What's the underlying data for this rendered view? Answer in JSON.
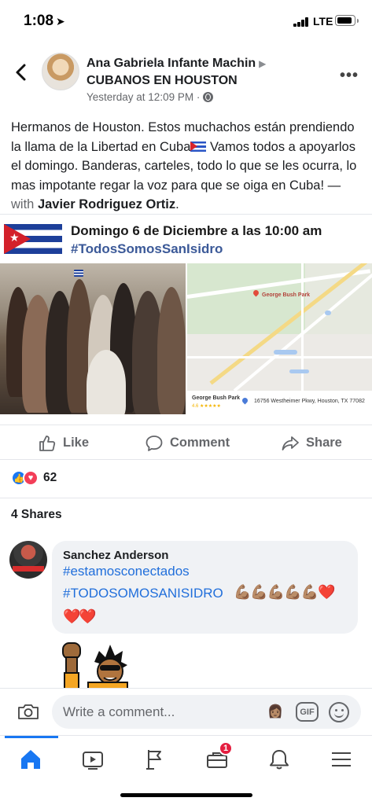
{
  "status_bar": {
    "time": "1:08",
    "network": "LTE"
  },
  "post": {
    "author": "Ana Gabriela Infante Machin",
    "group": "CUBANOS EN HOUSTON",
    "timestamp": "Yesterday at 12:09 PM · ",
    "text_part1": "Hermanos de Houston. Estos muchachos están prendiendo la llama de la Libertad en Cuba",
    "text_part2": " Vamos todos a apoyarlos el domingo. Banderas, carteles, todo lo que se les ocurra, lo mas impotante regar la voz para que se oiga en Cuba! — ",
    "with_label": "with ",
    "tagged": "Javier Rodriguez Ortiz",
    "end": "."
  },
  "shared_image": {
    "banner_line1": "Domingo 6 de Diciembre a las 10:00 am",
    "banner_line2": "#TodosSomosSanIsidro",
    "map_place_label": "George Bush Park",
    "map_footer_name": "George Bush Park",
    "map_footer_rating": "4.6 ★★★★★",
    "map_footer_address": "16756 Westheimer Pkwy, Houston, TX 77082"
  },
  "actions": {
    "like": "Like",
    "comment": "Comment",
    "share": "Share"
  },
  "reactions": {
    "count": "62"
  },
  "shares": "4 Shares",
  "comment": {
    "author": "Sanchez Anderson",
    "tag1": "#estamosconectados",
    "tag2": "#TODOSOMOSANISIDRO",
    "emojis": "💪🏽💪🏽💪🏽💪🏽💪🏽",
    "heart": "❤️",
    "hearts": "❤️❤️"
  },
  "composer": {
    "placeholder": "Write a comment...",
    "gif": "GIF"
  },
  "tabbar": {
    "badge": "1"
  },
  "colors": {
    "accent": "#1877f2",
    "link": "#216fdb",
    "badge": "#e41e3f"
  },
  "icons": [
    "back-icon",
    "globe-icon",
    "more-icon",
    "like-icon",
    "comment-icon",
    "share-icon",
    "camera-icon",
    "gif-icon",
    "emoji-icon",
    "home-icon",
    "watch-icon",
    "pages-icon",
    "marketplace-icon",
    "notifications-icon",
    "menu-icon"
  ]
}
